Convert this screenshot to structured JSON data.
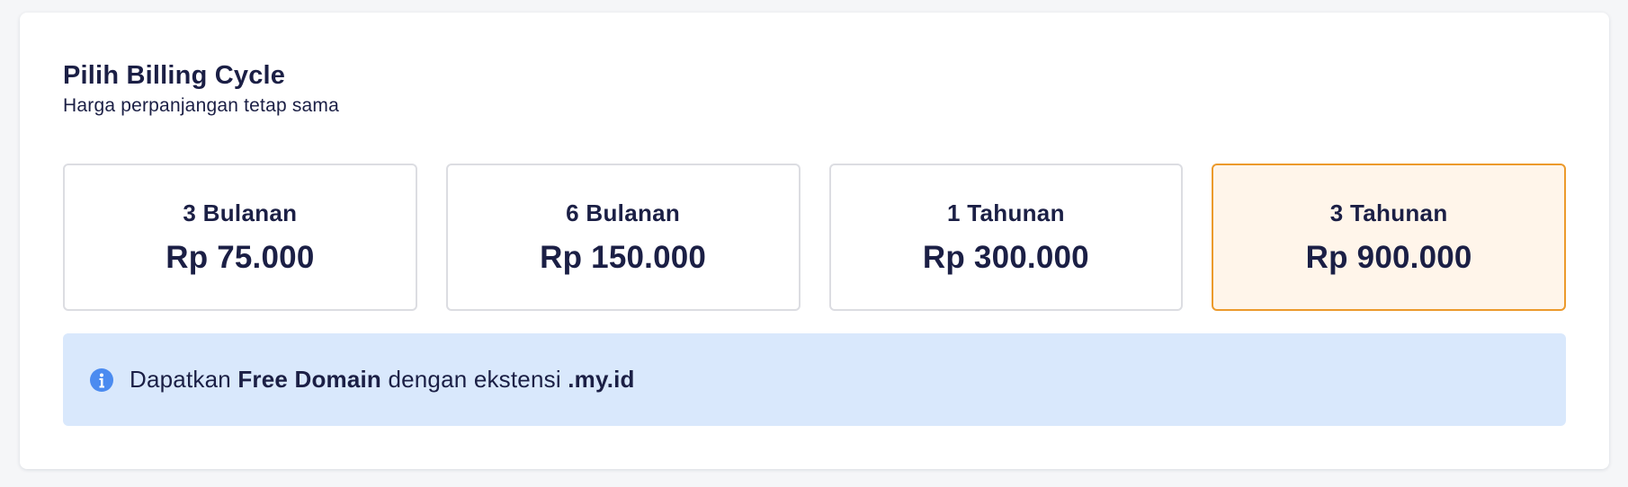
{
  "header": {
    "title": "Pilih Billing Cycle",
    "subtitle": "Harga perpanjangan tetap sama"
  },
  "options": [
    {
      "label": "3 Bulanan",
      "price": "Rp 75.000",
      "selected": false
    },
    {
      "label": "6 Bulanan",
      "price": "Rp 150.000",
      "selected": false
    },
    {
      "label": "1 Tahunan",
      "price": "Rp 300.000",
      "selected": false
    },
    {
      "label": "3 Tahunan",
      "price": "Rp 900.000",
      "selected": true
    }
  ],
  "info": {
    "icon": "info-circle-icon",
    "prefix": "Dapatkan ",
    "highlight": "Free Domain",
    "middle": " dengan ekstensi ",
    "extension": ".my.id"
  },
  "colors": {
    "text": "#1b1f45",
    "selected_border": "#ec9a2c",
    "selected_bg": "#fff5ea",
    "info_bg": "#d9e8fc",
    "info_icon": "#4b8bf0"
  }
}
